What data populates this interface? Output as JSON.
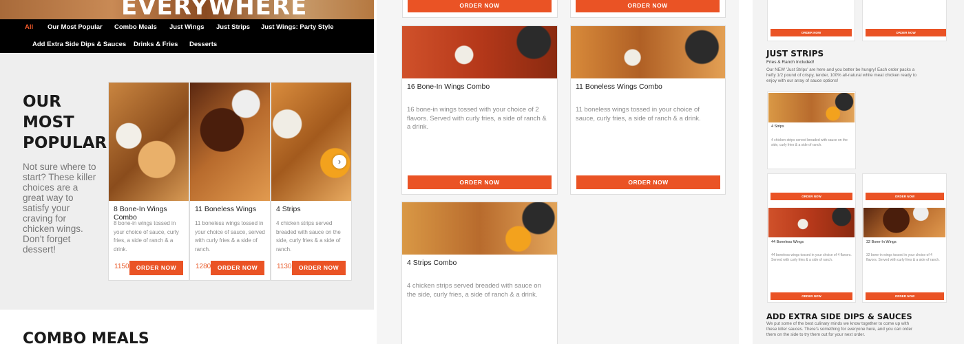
{
  "hero": {
    "title": "EVERYWHERE"
  },
  "nav": {
    "items": [
      "All",
      "Our Most Popular",
      "Combo Meals",
      "Just Wings",
      "Just Strips",
      "Just Wings: Party Style",
      "Add Extra Side Dips & Sauces",
      "Drinks & Fries",
      "Desserts"
    ],
    "active": "All"
  },
  "popular": {
    "title": "OUR MOST POPULAR",
    "description": "Not sure where to start? These killer choices are a great way to satisfy your craving for chicken wings. Don't forget dessert!",
    "cards": [
      {
        "name": "8 Bone-In Wings Combo",
        "description": "8 bone-in wings tossed in your choice of sauce, curly fries, a side of ranch & a drink.",
        "calories": "1150",
        "button": "ORDER NOW"
      },
      {
        "name": "11 Boneless Wings",
        "description": "11 boneless wings tossed in your choice of sauce, served with curly fries & a side of ranch.",
        "calories": "1280",
        "button": "ORDER NOW"
      },
      {
        "name": "4 Strips",
        "description": "4 chicken strips served breaded with sauce on the side, curly fries & a side of ranch.",
        "calories": "1130",
        "button": "ORDER NOW"
      }
    ]
  },
  "combo": {
    "title": "COMBO MEALS"
  },
  "panel2": {
    "top_buttons": [
      "ORDER NOW",
      "ORDER NOW"
    ],
    "cards": [
      {
        "name": "16 Bone-In Wings Combo",
        "description": "16 bone-in wings tossed with your choice of 2 flavors. Served with curly fries, a side of ranch & a drink.",
        "button": "ORDER NOW"
      },
      {
        "name": "11 Boneless Wings Combo",
        "description": "11 boneless wings tossed in your choice of sauce, curly fries, a side of ranch & a drink.",
        "button": "ORDER NOW"
      },
      {
        "name": "4 Strips Combo",
        "description": "4 chicken strips served breaded with sauce on the side, curly fries, a side of ranch & a drink."
      }
    ]
  },
  "panel3": {
    "top_buttons": [
      "ORDER NOW",
      "ORDER NOW"
    ],
    "strips": {
      "title": "JUST STRIPS",
      "subtitle": "Fries & Ranch Included!",
      "description": "Our NEW 'Just Strips' are here and you better be hungry! Each order packs a hefty 1/2 pound of crispy, tender, 100% all-natural white meat chicken ready to enjoy with our array of sauce options!",
      "card": {
        "name": "4 Strips",
        "description": "4 chicken strips served breaded with sauce on the side, curly fries & a side of ranch."
      }
    },
    "mid_buttons": [
      "ORDER NOW",
      "ORDER NOW"
    ],
    "wings_cards": [
      {
        "name": "44 Boneless Wings",
        "description": "44 boneless wings tossed in your choice of 4 flavors. Served with curly fries & a side of ranch.",
        "button": "ORDER NOW"
      },
      {
        "name": "32 Bone-In Wings",
        "description": "32 bone-in wings tossed in your choice of 4 flavors. Served with curly fries & a side of ranch.",
        "button": "ORDER NOW"
      }
    ],
    "dips": {
      "title": "ADD EXTRA SIDE DIPS & SAUCES",
      "description": "We put some of the best culinary minds we know together to come up with these killer sauces. There's something for everyone here, and you can order them on the side to try them out for your next order."
    }
  }
}
